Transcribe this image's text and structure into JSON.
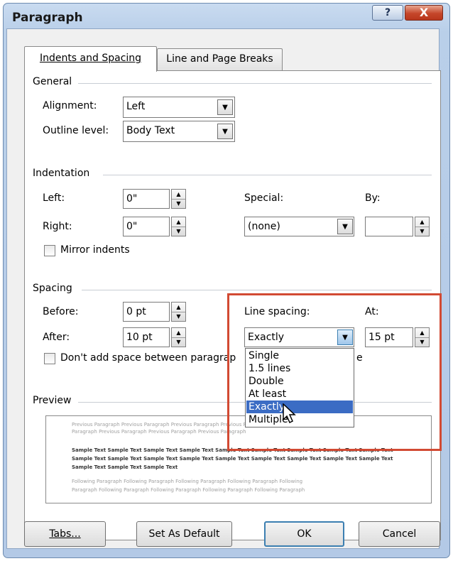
{
  "window": {
    "title": "Paragraph",
    "help_glyph": "?",
    "close_glyph": "X"
  },
  "tabs": [
    {
      "label": "Indents and Spacing",
      "active": true
    },
    {
      "label": "Line and Page Breaks",
      "active": false
    }
  ],
  "general": {
    "heading": "General",
    "alignment_label": "Alignment:",
    "alignment_value": "Left",
    "outline_label": "Outline level:",
    "outline_value": "Body Text"
  },
  "indentation": {
    "heading": "Indentation",
    "left_label": "Left:",
    "left_value": "0\"",
    "right_label": "Right:",
    "right_value": "0\"",
    "special_label": "Special:",
    "special_value": "(none)",
    "by_label": "By:",
    "by_value": "",
    "mirror_label": "Mirror indents"
  },
  "spacing": {
    "heading": "Spacing",
    "before_label": "Before:",
    "before_value": "0 pt",
    "after_label": "After:",
    "after_value": "10 pt",
    "line_spacing_label": "Line spacing:",
    "line_spacing_value": "Exactly",
    "at_label": "At:",
    "at_value": "15 pt",
    "dont_add_label": "Don't add space between paragrap",
    "dont_add_tail": "e",
    "line_spacing_options": [
      "Single",
      "1.5 lines",
      "Double",
      "At least",
      "Exactly",
      "Multiple"
    ],
    "selected_option": "Exactly"
  },
  "preview": {
    "heading": "Preview",
    "prev_text": "Previous Paragraph Previous Paragraph Previous Paragraph Previous Paragraph",
    "prev_text2": "Paragraph Previous Paragraph Previous Paragraph Previous Paragraph",
    "sample1": "Sample Text Sample Text Sample Text Sample Text Sample Text Sample Text Sample Text Sample Text Sample Text",
    "sample2": "Sample Text Sample Text Sample Text Sample Text Sample Text Sample Text Sample Text Sample Text Sample Text",
    "sample3": "Sample Text Sample Text Sample Text",
    "follow1": "Following Paragraph Following Paragraph Following Paragraph Following Paragraph Following",
    "follow2": "Paragraph Following Paragraph Following Paragraph Following Paragraph Following Paragraph"
  },
  "buttons": {
    "tabs": "Tabs...",
    "set_default": "Set As Default",
    "ok": "OK",
    "cancel": "Cancel"
  },
  "icons": {
    "dropdown_arrow": "▼",
    "spin_up": "▲",
    "spin_down": "▼"
  },
  "colors": {
    "highlight": "#d24a33",
    "selection": "#3b6cc4"
  }
}
